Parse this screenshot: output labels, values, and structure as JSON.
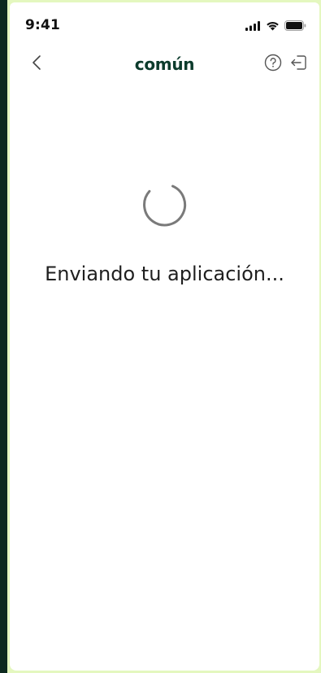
{
  "status_bar": {
    "time": "9:41",
    "icons": [
      "cellular-signal-icon",
      "wifi-icon",
      "battery-icon"
    ]
  },
  "nav": {
    "back_icon": "chevron-left-icon",
    "brand": "común",
    "help_icon": "question-circle-icon",
    "exit_icon": "logout-icon"
  },
  "content": {
    "spinner_icon": "loading-spinner-icon",
    "message": "Enviando tu aplicación..."
  },
  "colors": {
    "frame_border": "#e4f7bf",
    "outer_background": "#0d2a1f",
    "brand_text": "#0c3b2c",
    "spinner": "#7a7a7a"
  }
}
